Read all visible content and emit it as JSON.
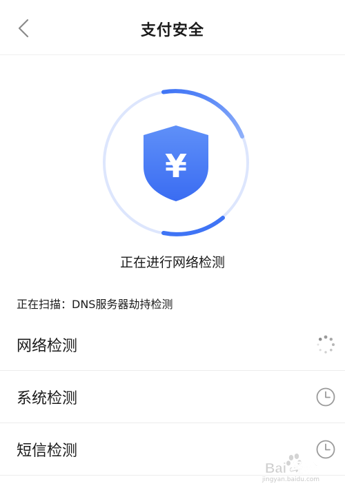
{
  "header": {
    "title": "支付安全",
    "back_icon": "chevron-left-icon"
  },
  "scanner": {
    "shield_icon": "shield-yuan-icon",
    "symbol": "¥",
    "progress": 0.55,
    "colors": {
      "accent": "#3f74f5",
      "track": "#dde6fd",
      "shield_top": "#5a8bf7",
      "shield_bottom": "#3b6ef3"
    }
  },
  "status_text": "正在进行网络检测",
  "scan_line": "正在扫描：DNS服务器劫持检测",
  "checks": [
    {
      "label": "网络检测",
      "status": "scanning",
      "icon": "loading-spinner-icon"
    },
    {
      "label": "系统检测",
      "status": "pending",
      "icon": "clock-icon"
    },
    {
      "label": "短信检测",
      "status": "pending",
      "icon": "clock-icon"
    }
  ],
  "watermark": {
    "logo_text": "Bai 经验",
    "url": "jingyan.baidu.com"
  }
}
